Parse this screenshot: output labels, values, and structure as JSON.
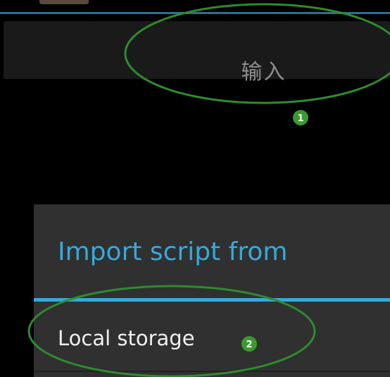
{
  "input_button": {
    "label": "输入"
  },
  "dialog": {
    "title": "Import script from",
    "options": [
      {
        "label": "Local storage"
      }
    ]
  },
  "annotations": [
    {
      "number": "1",
      "target": "input_button"
    },
    {
      "number": "2",
      "target": "dialog.options.0"
    }
  ],
  "colors": {
    "background": "#000000",
    "accent": "#35a8d9",
    "dialog_background": "#303030",
    "input_bar_background": "#1a1a1a",
    "annotation_green": "#2e8b2e",
    "badge_green": "#3a9a2f"
  }
}
